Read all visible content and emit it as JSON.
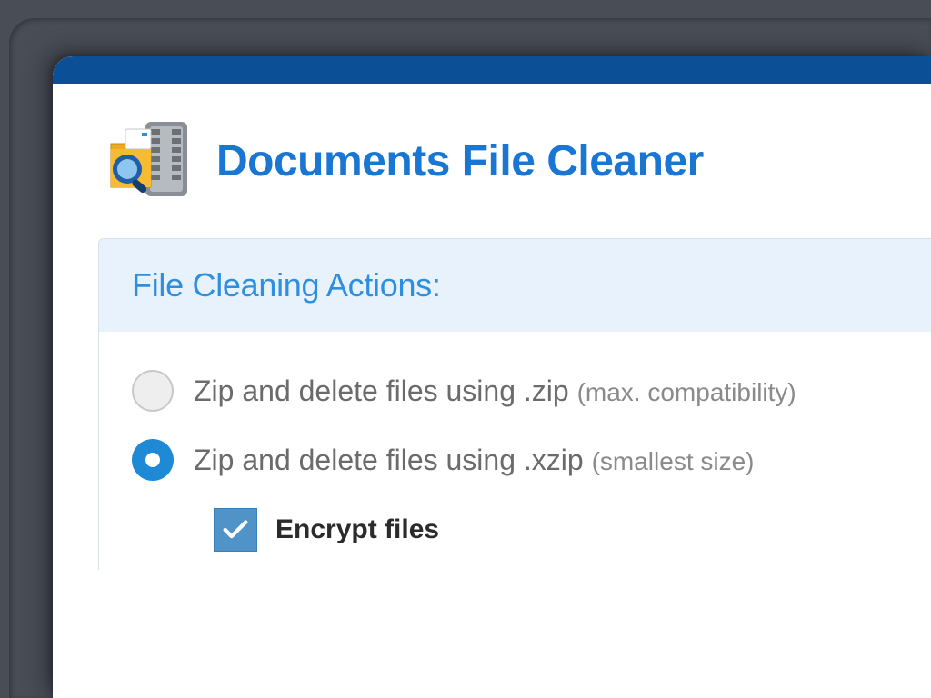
{
  "header": {
    "title": "Documents File Cleaner"
  },
  "panel": {
    "title": "File Cleaning Actions:"
  },
  "options": {
    "zip": {
      "label": "Zip and delete files using .zip ",
      "hint": "(max. compatibility)",
      "selected": false
    },
    "xzip": {
      "label": "Zip and delete files using .xzip ",
      "hint": "(smallest size)",
      "selected": true
    }
  },
  "sub_option": {
    "encrypt": {
      "label": "Encrypt files",
      "checked": true
    }
  }
}
